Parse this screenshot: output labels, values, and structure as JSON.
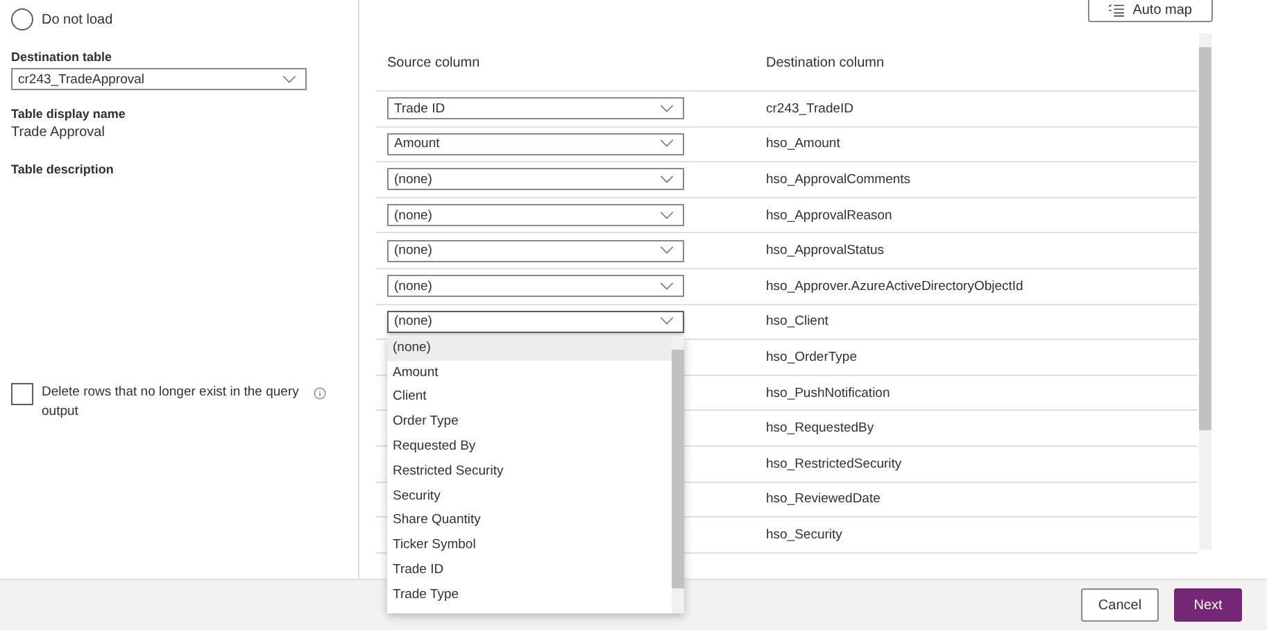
{
  "load_options": [
    {
      "label": "Do not load",
      "selected": false
    }
  ],
  "destination_table": {
    "label": "Destination table",
    "value": "cr243_TradeApproval"
  },
  "table_display_name": {
    "label": "Table display name",
    "value": "Trade Approval"
  },
  "table_description": {
    "label": "Table description"
  },
  "delete_rows": {
    "label": "Delete rows that no longer exist in the query output",
    "checked": false
  },
  "auto_map": {
    "label": "Auto map"
  },
  "mapping": {
    "columns": [
      "Source column",
      "Destination column"
    ],
    "rows": [
      {
        "source": "Trade ID",
        "destination": "cr243_TradeID"
      },
      {
        "source": "Amount",
        "destination": "hso_Amount"
      },
      {
        "source": "(none)",
        "destination": "hso_ApprovalComments"
      },
      {
        "source": "(none)",
        "destination": "hso_ApprovalReason"
      },
      {
        "source": "(none)",
        "destination": "hso_ApprovalStatus"
      },
      {
        "source": "(none)",
        "destination": "hso_Approver.AzureActiveDirectoryObjectId"
      },
      {
        "source": "(none)",
        "destination": "hso_Client",
        "open": true
      },
      {
        "destination": "hso_OrderType"
      },
      {
        "destination": "hso_PushNotification"
      },
      {
        "destination": "hso_RequestedBy"
      },
      {
        "destination": "hso_RestrictedSecurity"
      },
      {
        "destination": "hso_ReviewedDate"
      },
      {
        "destination": "hso_Security"
      }
    ]
  },
  "dropdown_options": [
    {
      "label": "(none)",
      "selected": true
    },
    {
      "label": "Amount",
      "selected": false
    },
    {
      "label": "Client",
      "selected": false
    },
    {
      "label": "Order Type",
      "selected": false
    },
    {
      "label": "Requested By",
      "selected": false
    },
    {
      "label": "Restricted Security",
      "selected": false
    },
    {
      "label": "Security",
      "selected": false
    },
    {
      "label": "Share Quantity",
      "selected": false
    },
    {
      "label": "Ticker Symbol",
      "selected": false
    },
    {
      "label": "Trade ID",
      "selected": false
    },
    {
      "label": "Trade Type",
      "selected": false
    }
  ],
  "footer": {
    "buttons": [
      {
        "label": "Cancel",
        "kind": "secondary"
      },
      {
        "label": "Next",
        "kind": "primary"
      }
    ]
  }
}
